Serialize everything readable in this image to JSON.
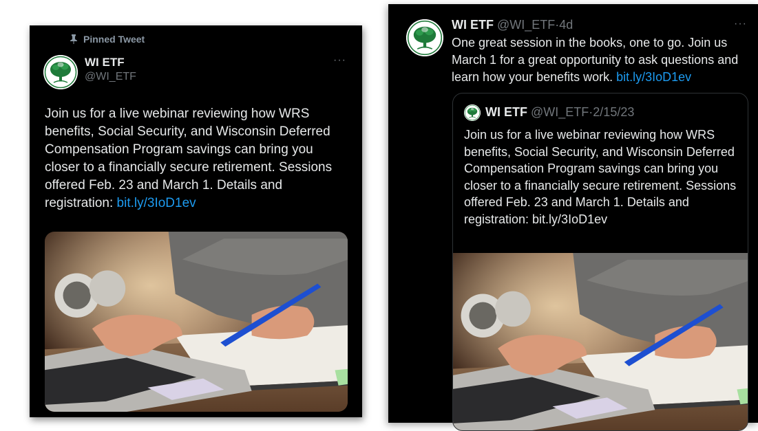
{
  "left_tweet": {
    "pinned_label": "Pinned Tweet",
    "display_name": "WI ETF",
    "handle": "@WI_ETF",
    "more": "···",
    "text": "Join us for a live webinar reviewing how WRS benefits, Social Security, and Wisconsin Deferred Compensation Program savings can bring you closer to a financially secure retirement. Sessions offered Feb. 23 and March 1. Details and registration: ",
    "link": "bit.ly/3IoD1ev",
    "media_icon": "photo-laptop-notebook"
  },
  "right_tweet": {
    "display_name": "WI ETF",
    "handle": "@WI_ETF",
    "separator": "·",
    "time": "4d",
    "more": "···",
    "text": "One great session in the books, one to go. Join us March 1 for a great opportunity to ask questions and learn how your benefits work. ",
    "link": "bit.ly/3IoD1ev",
    "quote": {
      "display_name": "WI ETF",
      "handle": "@WI_ETF",
      "separator": "·",
      "date": "2/15/23",
      "text": "Join us for a live webinar reviewing how WRS benefits, Social Security, and Wisconsin Deferred Compensation Program savings can bring you closer to a financially secure retirement. Sessions offered Feb. 23 and March 1. Details and registration: bit.ly/3IoD1ev"
    }
  },
  "colors": {
    "background": "#000000",
    "text": "#e7e9ea",
    "muted": "#71767b",
    "link": "#1d9bf0",
    "avatar_green": "#1f7a3a"
  }
}
